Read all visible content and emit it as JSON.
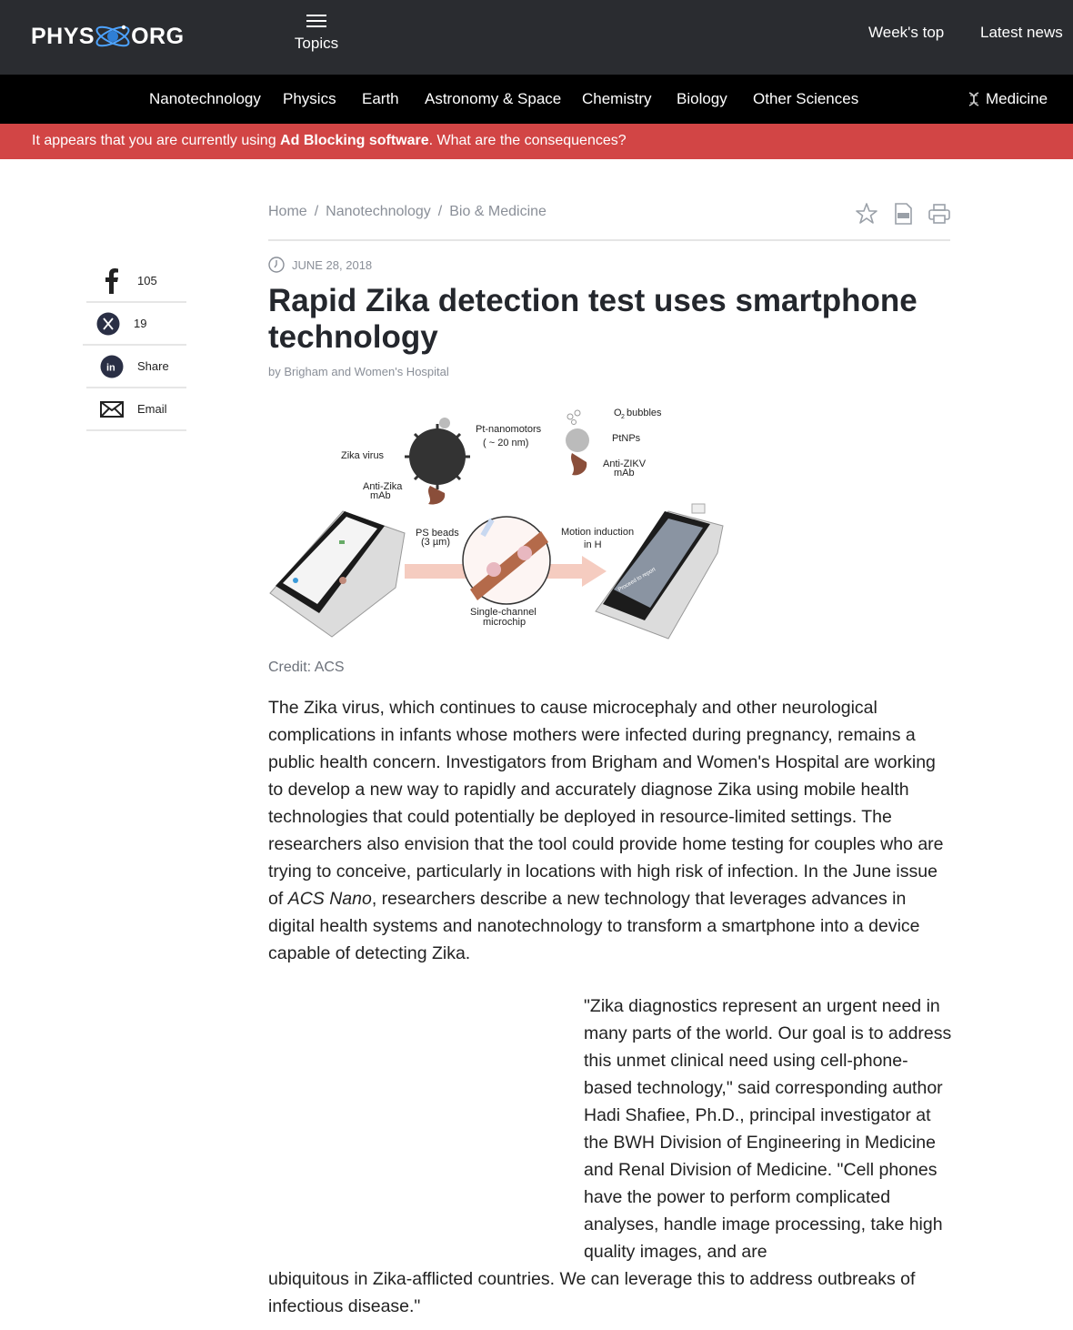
{
  "header": {
    "logo_left": "PHYS",
    "logo_right": "ORG",
    "topics_label": "Topics",
    "weeks_top": "Week's top",
    "latest_news": "Latest news"
  },
  "categories": [
    "Nanotechnology",
    "Physics",
    "Earth",
    "Astronomy & Space",
    "Chemistry",
    "Biology",
    "Other Sciences",
    "Medicine"
  ],
  "adblock": {
    "prefix": "It appears that you are currently using ",
    "link": "Ad Blocking software",
    "suffix": ". What are the consequences?"
  },
  "breadcrumb": [
    "Home",
    "Nanotechnology",
    "Bio & Medicine"
  ],
  "breadcrumb_separator": "/",
  "share": [
    {
      "icon": "facebook-icon",
      "label": "105"
    },
    {
      "icon": "x-twitter-icon",
      "label": "19"
    },
    {
      "icon": "linkedin-icon",
      "label": "Share"
    },
    {
      "icon": "email-icon",
      "label": "Email"
    }
  ],
  "article": {
    "date": "JUNE 28, 2018",
    "title": "Rapid Zika detection test uses smartphone technology",
    "byline": "by Brigham and Women's Hospital",
    "credit": "Credit: ACS",
    "para1_a": "The Zika virus, which continues to cause microcephaly and other neurological complications in infants whose mothers were infected during pregnancy, remains a public health concern. Investigators from Brigham and Women's Hospital are working to develop a new way to rapidly and accurately diagnose Zika using mobile health technologies that could potentially be deployed in resource-limited settings. The researchers also envision that the tool could provide home testing for couples who are trying to conceive, particularly in locations with high risk of infection. In the June issue of ",
    "para1_italic": "ACS Nano",
    "para1_b": ", researchers describe a new technology that leverages advances in digital health systems and nanotechnology to transform a smartphone into a device capable of detecting Zika.",
    "quote_part1": "\"Zika diagnostics represent an urgent need in many parts of the world. Our goal is to address this unmet clinical need using cell-phone-based technology,\" said corresponding author Hadi Shafiee, Ph.D., principal investigator at the BWH Division of Engineering in Medicine and Renal Division of Medicine. \"Cell phones have the power to perform complicated analyses, handle image processing, take high quality images, and are",
    "quote_part2": "ubiquitous in Zika-afflicted countries. We can leverage this to address outbreaks of infectious disease.\""
  },
  "figure_labels": {
    "pt_nanomotors": "Pt-nanomotors",
    "size": "( ~ 20 nm)",
    "o2_bubbles": "O",
    "o2_sub": "2",
    "bubbles": "bubbles",
    "ptnps": "PtNPs",
    "anti_zikv": "Anti-ZIKV",
    "anti_zikv2": "mAb",
    "zika_virus": "Zika virus",
    "anti_zika": "Anti-Zika",
    "anti_zika2": "mAb",
    "ps_beads": "PS beads",
    "ps_size": "(3 µm)",
    "motion": "Motion induction",
    "in_h2o2": "in H",
    "single_channel": "Single-channel",
    "microchip": "microchip",
    "proceed": "Proceed to report"
  }
}
